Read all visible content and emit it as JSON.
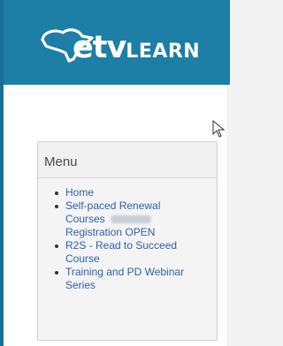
{
  "header": {
    "logo_main": "etv",
    "logo_suffix": "LEARN",
    "brand_color": "#1d7ea6"
  },
  "menu": {
    "heading": "Menu",
    "items": [
      {
        "lines": [
          "Home"
        ]
      },
      {
        "lines": [
          "Self-paced Renewal",
          "Courses",
          "Registration OPEN"
        ]
      },
      {
        "lines": [
          "R2S - Read to Succeed",
          "Course"
        ]
      },
      {
        "lines": [
          "Training and PD Webinar",
          "Series"
        ]
      }
    ]
  },
  "icons": {
    "logo": "state-outline-logo-icon",
    "pointer": "mouse-pointer-icon"
  }
}
